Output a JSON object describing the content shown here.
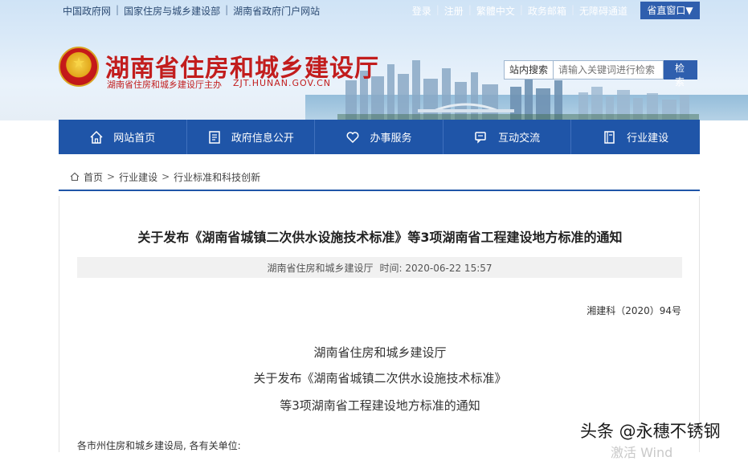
{
  "top_links": [
    "中国政府网",
    "国家住房与城乡建设部",
    "湖南省政府门户网站"
  ],
  "user_links": [
    "登录",
    "注册",
    "繁體中文",
    "政务邮箱",
    "无障碍通道"
  ],
  "dept_button": "省直窗口▼",
  "site": {
    "title": "湖南省住房和城乡建设厅",
    "sponsor": "湖南省住房和城乡建设厅主办",
    "url": "ZJT.HUNAN.GOV.CN"
  },
  "search": {
    "label": "站内搜索",
    "placeholder": "请输入关键词进行检索",
    "button": "检 索"
  },
  "nav": [
    {
      "label": "网站首页",
      "icon": "home-icon"
    },
    {
      "label": "政府信息公开",
      "icon": "document-icon"
    },
    {
      "label": "办事服务",
      "icon": "heart-icon"
    },
    {
      "label": "互动交流",
      "icon": "chat-icon"
    },
    {
      "label": "行业建设",
      "icon": "book-icon"
    }
  ],
  "breadcrumb": [
    "首页",
    "行业建设",
    "行业标准和科技创新"
  ],
  "article": {
    "title": "关于发布《湖南省城镇二次供水设施技术标准》等3项湖南省工程建设地方标准的通知",
    "source": "湖南省住房和城乡建设厅",
    "time_label": "时间:",
    "time": "2020-06-22 15:57",
    "doc_number": "湘建科（2020）94号",
    "heading_lines": [
      "湖南省住房和城乡建设厅",
      "关于发布《湖南省城镇二次供水设施技术标准》",
      "等3项湖南省工程建设地方标准的通知"
    ],
    "salutation": "各市州住房和城乡建设局, 各有关单位:"
  },
  "watermark": {
    "toutiao": "头条 @永穗不锈钢",
    "activate": "激活 Wind"
  },
  "colors": {
    "nav_blue": "#1f55a8",
    "title_red": "#c21d1d"
  }
}
